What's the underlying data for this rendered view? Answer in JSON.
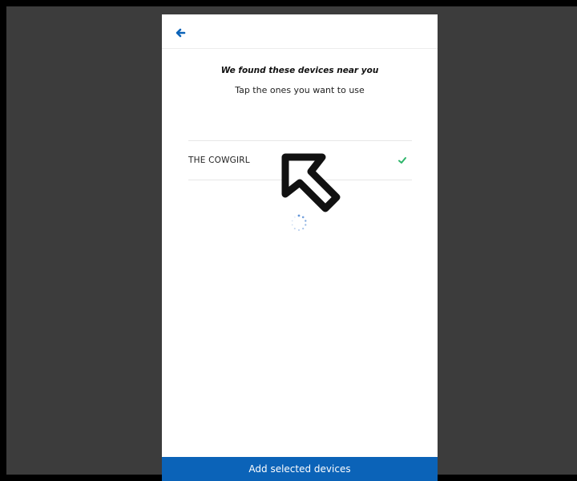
{
  "header": {
    "back_icon": "arrow-left-icon"
  },
  "content": {
    "title": "We found these devices near you",
    "subtitle": "Tap the ones you want to use"
  },
  "devices": [
    {
      "name": "THE COWGIRL",
      "selected": true,
      "check_icon": "checkmark-icon"
    }
  ],
  "loading": {
    "icon": "loading-spinner-icon"
  },
  "footer": {
    "add_button_label": "Add selected devices"
  },
  "overlay": {
    "cursor_icon": "mouse-pointer-icon"
  },
  "colors": {
    "accent": "#0b63b8",
    "check": "#2db56a",
    "backdrop": "#3c3c3c"
  }
}
